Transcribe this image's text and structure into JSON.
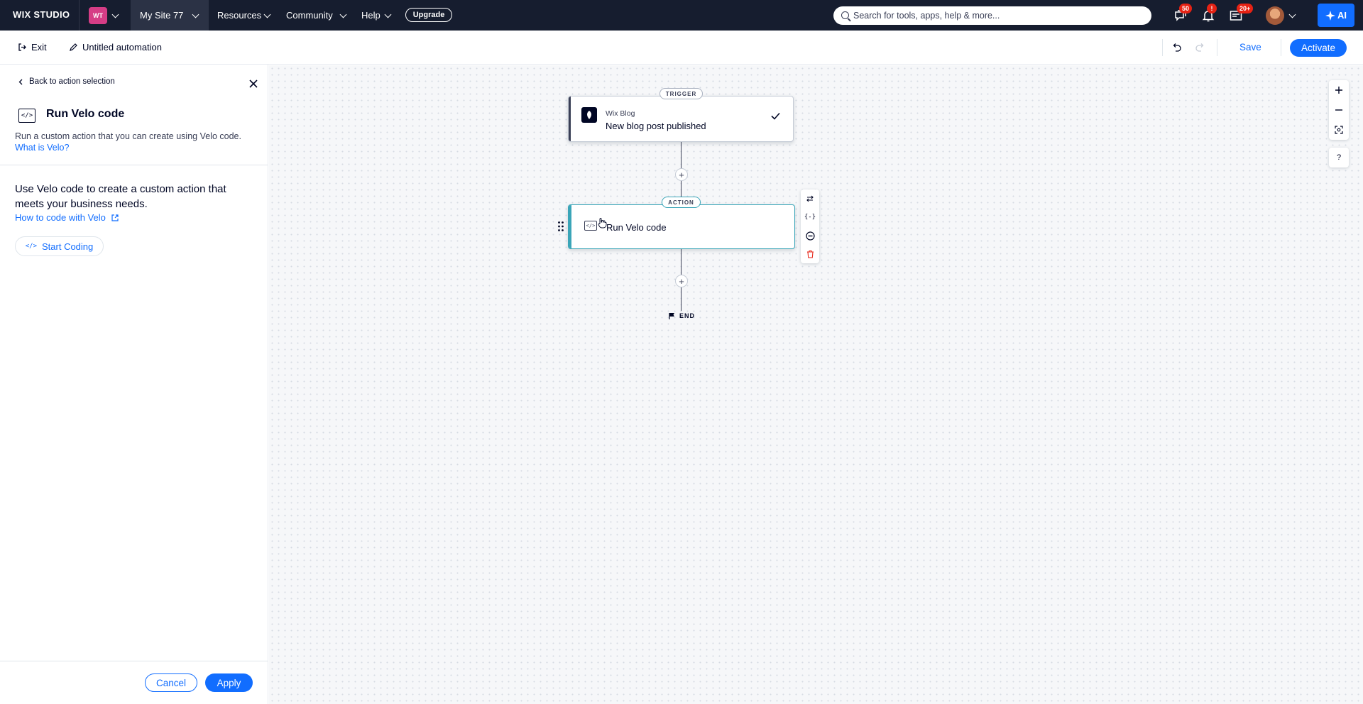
{
  "topbar": {
    "logo_text": "WIX STUDIO",
    "workspace_initials": "WT",
    "site_name": "My Site 77",
    "nav": [
      "Resources",
      "Community",
      "Help"
    ],
    "upgrade_label": "Upgrade",
    "search_placeholder": "Search for tools, apps, help & more...",
    "badges": {
      "messages": "50",
      "notifications": "!",
      "updates": "20+"
    },
    "ai_label": "AI"
  },
  "subbar": {
    "exit_label": "Exit",
    "automation_title": "Untitled automation",
    "save_label": "Save",
    "activate_label": "Activate"
  },
  "panel": {
    "back_label": "Back to action selection",
    "title": "Run Velo code",
    "description": "Run a custom action that you can create using Velo code.",
    "what_is_link": "What is Velo?",
    "body_text": "Use Velo code to create a custom action that meets your business needs.",
    "howto_link": "How to code with Velo",
    "start_coding_label": "Start Coding",
    "cancel_label": "Cancel",
    "apply_label": "Apply"
  },
  "canvas": {
    "trigger_tag": "TRIGGER",
    "trigger_app": "Wix Blog",
    "trigger_name": "New blog post published",
    "action_tag": "ACTION",
    "action_name": "Run Velo code",
    "end_label": "END",
    "help_label": "?"
  },
  "colors": {
    "topbar_bg": "#161d2f",
    "accent_blue": "#116dff",
    "badge_red": "#e62214",
    "action_teal": "#3aa5b8",
    "workspace_pink": "#d63d86"
  }
}
